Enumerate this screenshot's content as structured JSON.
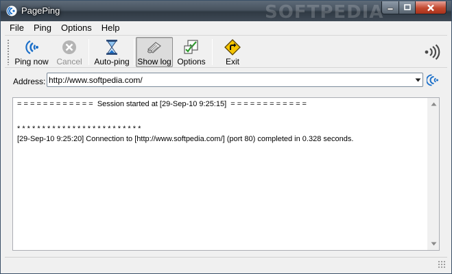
{
  "window": {
    "title": "PagePing",
    "watermark": "SOFTPEDIA",
    "controls": {
      "minimize": "minimize",
      "maximize": "maximize",
      "close": "close"
    }
  },
  "menu": {
    "items": [
      {
        "label": "File"
      },
      {
        "label": "Ping"
      },
      {
        "label": "Options"
      },
      {
        "label": "Help"
      }
    ]
  },
  "toolbar": {
    "ping_now": "Ping now",
    "cancel": "Cancel",
    "auto_ping": "Auto-ping",
    "show_log": "Show log",
    "options": "Options",
    "exit": "Exit"
  },
  "address": {
    "label": "Address:",
    "value": "http://www.softpedia.com/"
  },
  "log": {
    "lines": [
      "= = = = = = = = = = = =  Session started at [29-Sep-10 9:25:15]  = = = = = = = = = = = =",
      "",
      "",
      "* * * * * * * * * * * * * * * * * * * * * * * * *",
      "[29-Sep-10 9:25:20] Connection to [http://www.softpedia.com/] (port 80) completed in 0.328 seconds."
    ]
  },
  "status": {
    "text": ""
  },
  "colors": {
    "accent_blue": "#1b6fc9",
    "exit_sign": "#f5c400",
    "close_red": "#c2492f"
  },
  "icons": {
    "ping_now": "ping-wave-icon",
    "cancel": "cancel-x-icon",
    "auto_ping": "hourglass-icon",
    "show_log": "log-document-icon",
    "options": "options-checklist-icon",
    "exit": "exit-sign-icon",
    "signal": "signal-strength-icon"
  }
}
